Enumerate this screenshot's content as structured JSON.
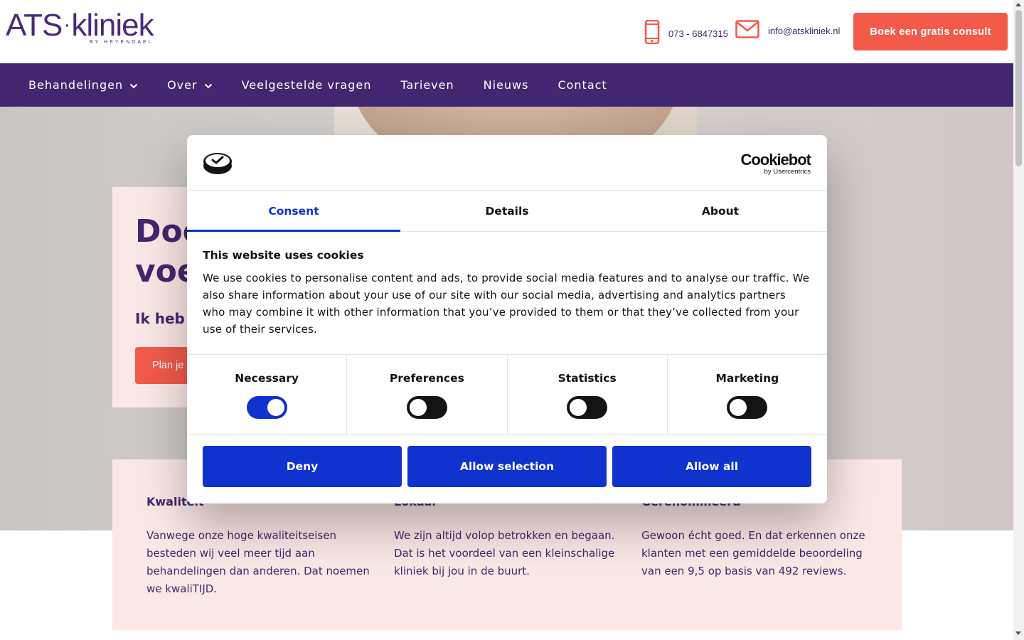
{
  "header": {
    "logo": {
      "brand_left": "ATS",
      "brand_right": "kliniek",
      "tagline": "BY HEYENDAEL"
    },
    "phone": "073 - 6847315",
    "email": "info@atskliniek.nl",
    "cta_label": "Boek een gratis consult"
  },
  "nav": {
    "items": [
      {
        "label": "Behandelingen",
        "has_dropdown": true
      },
      {
        "label": "Over",
        "has_dropdown": true
      },
      {
        "label": "Veelgestelde vragen"
      },
      {
        "label": "Tarieven"
      },
      {
        "label": "Nieuws"
      },
      {
        "label": "Contact"
      }
    ]
  },
  "hero": {
    "title_line1": "Doe",
    "title_line2": "voe",
    "subtitle": "Ik heb i",
    "button_label": "Plan je"
  },
  "features": [
    {
      "title": "Kwaliteit",
      "text": "Vanwege onze hoge kwaliteitseisen besteden wij veel meer tijd aan behandelingen dan anderen. Dat noemen we kwaliTIJD."
    },
    {
      "title": "Lokaal",
      "text": "We zijn altijd volop betrokken en begaan. Dat is het voordeel van een kleinschalige kliniek bij jou in de buurt."
    },
    {
      "title": "Gerenommeerd",
      "text": "Gewoon écht goed. En dat erkennen onze klanten met een gemiddelde beoordeling van een 9,5 op basis van 492 reviews."
    }
  ],
  "cookie_modal": {
    "brand_name": "Cookiebot",
    "brand_by": "by Usercentrics",
    "tabs": [
      {
        "label": "Consent",
        "active": true
      },
      {
        "label": "Details",
        "active": false
      },
      {
        "label": "About",
        "active": false
      }
    ],
    "heading": "This website uses cookies",
    "body": "We use cookies to personalise content and ads, to provide social media features and to analyse our traffic. We also share information about your use of our site with our social media, advertising and analytics partners who may combine it with other information that you’ve provided to them or that they’ve collected from your use of their services.",
    "toggles": [
      {
        "label": "Necessary",
        "on": true
      },
      {
        "label": "Preferences",
        "on": false
      },
      {
        "label": "Statistics",
        "on": false
      },
      {
        "label": "Marketing",
        "on": false
      }
    ],
    "buttons": {
      "deny": "Deny",
      "allow_selection": "Allow selection",
      "allow_all": "Allow all"
    }
  },
  "colors": {
    "brand_purple": "#432670",
    "accent_coral": "#f35a4a",
    "cookie_blue": "#1032cf",
    "feature_bg": "#fbe9e7"
  }
}
